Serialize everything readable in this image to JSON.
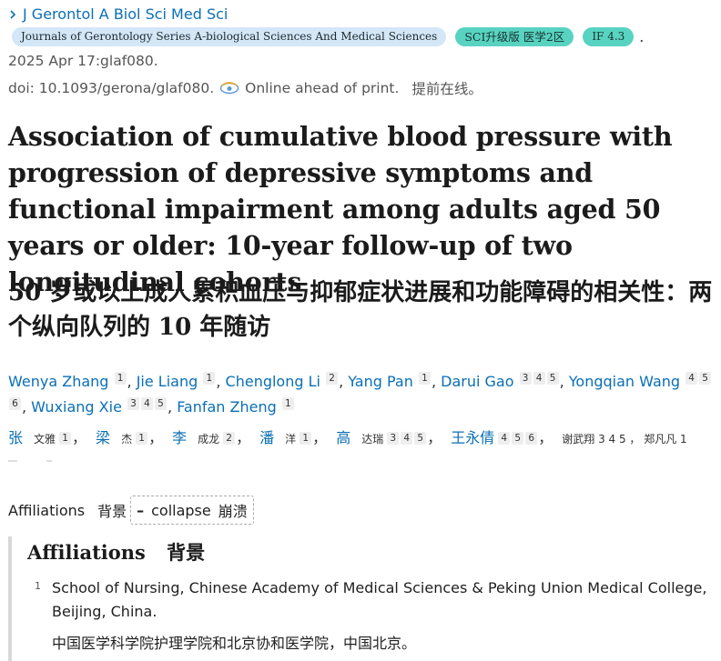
{
  "journal": {
    "short_name": "J Gerontol A Biol Sci Med Sci",
    "full_name": "Journals of Gerontology Series A-biological Sciences And Medical Sciences",
    "sci_badge": "SCI升级版 医学2区",
    "if_badge": "IF 4.3",
    "badge_color": "#58d3c1",
    "journal_badge_color": "#d3e7f7"
  },
  "citation": {
    "date_line": "2025 Apr 17:glaf080.",
    "doi_text": "doi: 10.1093/gerona/glaf080.",
    "status_en": "Online ahead of print.",
    "status_zh": "提前在线。"
  },
  "title": {
    "en": "Association of cumulative blood pressure with progression of depressive symptoms and functional impairment among adults aged 50 years or older: 10-year follow-up of two longitudinal cohorts",
    "zh": "50 岁或以上成人累积血压与抑郁症状进展和功能障碍的相关性：两个纵向队列的 10 年随访"
  },
  "authors": [
    {
      "name": "Wenya Zhang",
      "aff": [
        "1"
      ]
    },
    {
      "name": "Jie Liang",
      "aff": [
        "1"
      ]
    },
    {
      "name": "Chenglong Li",
      "aff": [
        "2"
      ]
    },
    {
      "name": "Yang Pan",
      "aff": [
        "1"
      ]
    },
    {
      "name": "Darui Gao",
      "aff": [
        "3",
        "4",
        "5"
      ]
    },
    {
      "name": "Yongqian Wang",
      "aff": [
        "4",
        "5",
        "6"
      ]
    },
    {
      "name": "Wuxiang Xie",
      "aff": [
        "3",
        "4",
        "5"
      ]
    },
    {
      "name": "Fanfan Zheng",
      "aff": [
        "1"
      ]
    }
  ],
  "authors_zh": [
    {
      "surname": "张",
      "given": "文雅",
      "aff": [
        "1"
      ]
    },
    {
      "surname": "梁",
      "given": "杰",
      "aff": [
        "1"
      ]
    },
    {
      "surname": "李",
      "given": "成龙",
      "aff": [
        "2"
      ]
    },
    {
      "surname": "潘",
      "given": "洋",
      "aff": [
        "1"
      ]
    },
    {
      "surname": "高",
      "given": "达瑞",
      "aff": [
        "3",
        "4",
        "5"
      ]
    },
    {
      "surname": "王永倩",
      "given": "",
      "aff": [
        "4",
        "5",
        "6"
      ]
    }
  ],
  "authors_zh_tail": "谢武翔 3 4 5 ， 郑凡凡 1",
  "comma_zh": "，",
  "affiliations_toggle": {
    "label_en": "Affiliations",
    "label_zh": "背景",
    "collapse_symbol": "–",
    "collapse_en": "collapse",
    "collapse_zh": "崩溃"
  },
  "affiliations_panel": {
    "heading_en": "Affiliations",
    "heading_zh": "背景",
    "items": [
      {
        "num": "1",
        "text_en": "School of Nursing, Chinese Academy of Medical Sciences & Peking Union Medical College, Beijing, China.",
        "text_zh": "中国医学科学院护理学院和北京协和医学院，中国北京。"
      }
    ]
  }
}
